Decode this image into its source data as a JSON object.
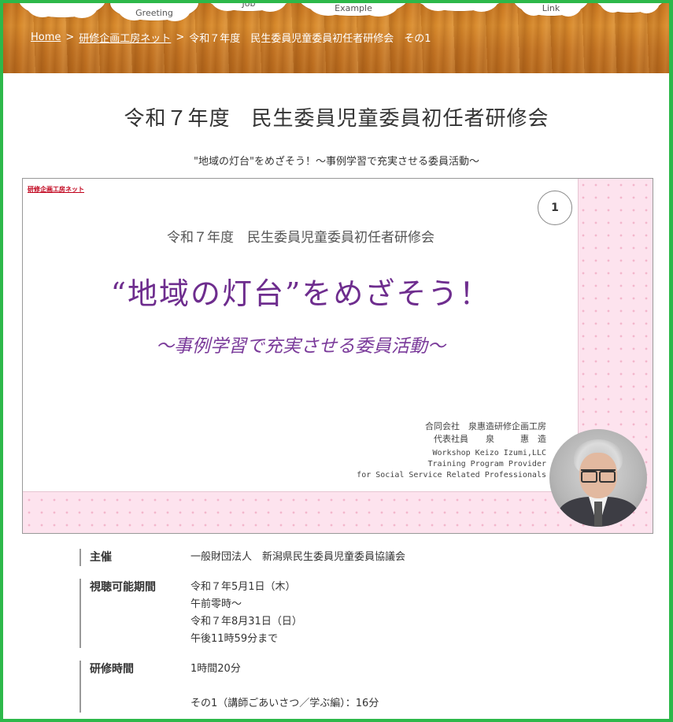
{
  "nav": {
    "items": [
      {
        "label": ""
      },
      {
        "label": "Greeting"
      },
      {
        "label": "Job"
      },
      {
        "label": "Example"
      },
      {
        "label": ""
      },
      {
        "label": "Link"
      },
      {
        "label": ""
      }
    ]
  },
  "breadcrumb": {
    "home": "Home",
    "parent": "研修企画工房ネット",
    "separator": ">",
    "current": "令和７年度　民生委員児童委員初任者研修会　その1"
  },
  "page": {
    "title": "令和７年度　民生委員児童委員初任者研修会",
    "subtitle": "\"地域の灯台\"をめざそう！～事例学習で充実させる委員活動～"
  },
  "slide": {
    "logo": "研修企画工房ネット",
    "number": "1",
    "line1": "令和７年度　民生委員児童委員初任者研修会",
    "line2": "“地域の灯台”をめざそう！",
    "line3": "～事例学習で充実させる委員活動～",
    "company": "合同会社　泉惠造研修企画工房",
    "representative": "代表社員　　泉　　　惠　造",
    "eng1": "Workshop Keizo Izumi,LLC",
    "eng2": "Training Program Provider",
    "eng3": "for Social Service Related Professionals"
  },
  "info": {
    "host_key": "主催",
    "host_val": "一般財団法人　新潟県民生委員児童委員協議会",
    "period_key": "視聴可能期間",
    "period_lines": [
      "令和７年5月1日（木）",
      "午前零時～",
      "令和７年8月31日（日）",
      "午後11時59分まで"
    ],
    "time_key": "研修時間",
    "time_lines": [
      "1時間20分",
      "",
      "その1（講師ごあいさつ／学ぶ編）：16分"
    ]
  },
  "colors": {
    "frame": "#2db84a",
    "title_purple": "#6e2d8e",
    "slide_pink": "#fde3ee"
  }
}
